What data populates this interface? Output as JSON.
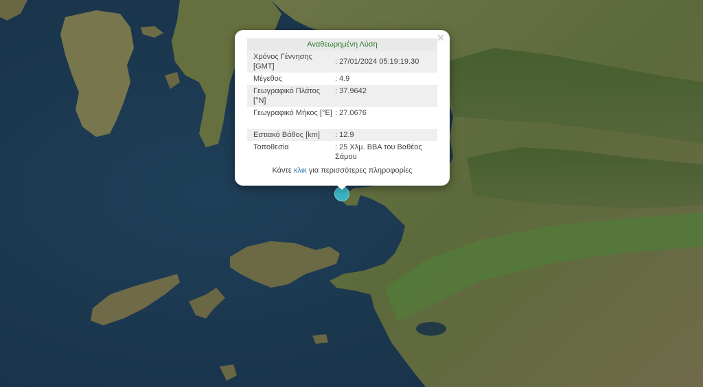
{
  "popup": {
    "title": "Αναθεωρημένη Λύση",
    "close_label": "×",
    "rows": [
      {
        "label": "Χρόνος Γέννησης [GMT]",
        "value": ": 27/01/2024 05:19:19.30"
      },
      {
        "label": "Μέγεθος",
        "value": ": 4.9"
      },
      {
        "label": "Γεωγραφικό Πλάτος [°N]",
        "value": ": 37.9642"
      },
      {
        "label": "Γεωγραφικό Μήκος [°E]",
        "value": ": 27.0676"
      },
      {
        "label": "Εστιακό Βάθος [km]",
        "value": ": 12.9"
      },
      {
        "label": "Τοποθεσία",
        "value": ": 25 Χλμ. ΒΒΑ του Βαθέος Σάμου"
      }
    ],
    "more": {
      "before": "Κάντε ",
      "link": "κλικ",
      "after": " για περισσότερες πληροφορίες"
    }
  },
  "map": {
    "sea_color": "#1d3a52",
    "land_color": "#5b6a3c",
    "marker_color": "#3bb3c3"
  }
}
